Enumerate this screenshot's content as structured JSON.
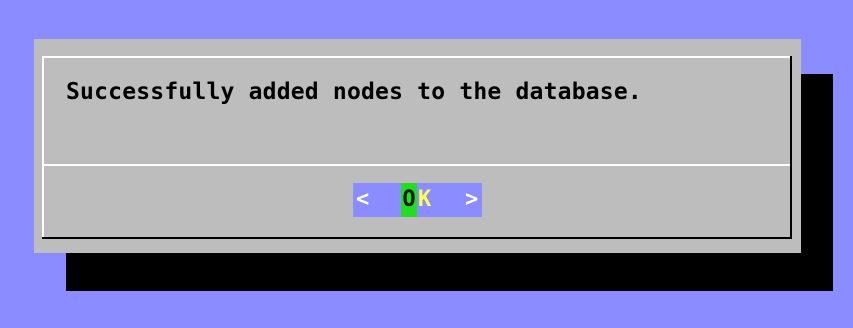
{
  "dialog": {
    "message": "Successfully added nodes to the database.",
    "ok_button": {
      "left_bracket": "<",
      "hotkey": "O",
      "label_rest": "K",
      "right_bracket": ">"
    }
  },
  "colors": {
    "background": "#8a8cff",
    "dialog": "#bdbdbd",
    "shadow": "#000000",
    "button_bg": "#8a8cff",
    "hotkey_bg": "#22dd22",
    "button_text": "#ffff55"
  }
}
